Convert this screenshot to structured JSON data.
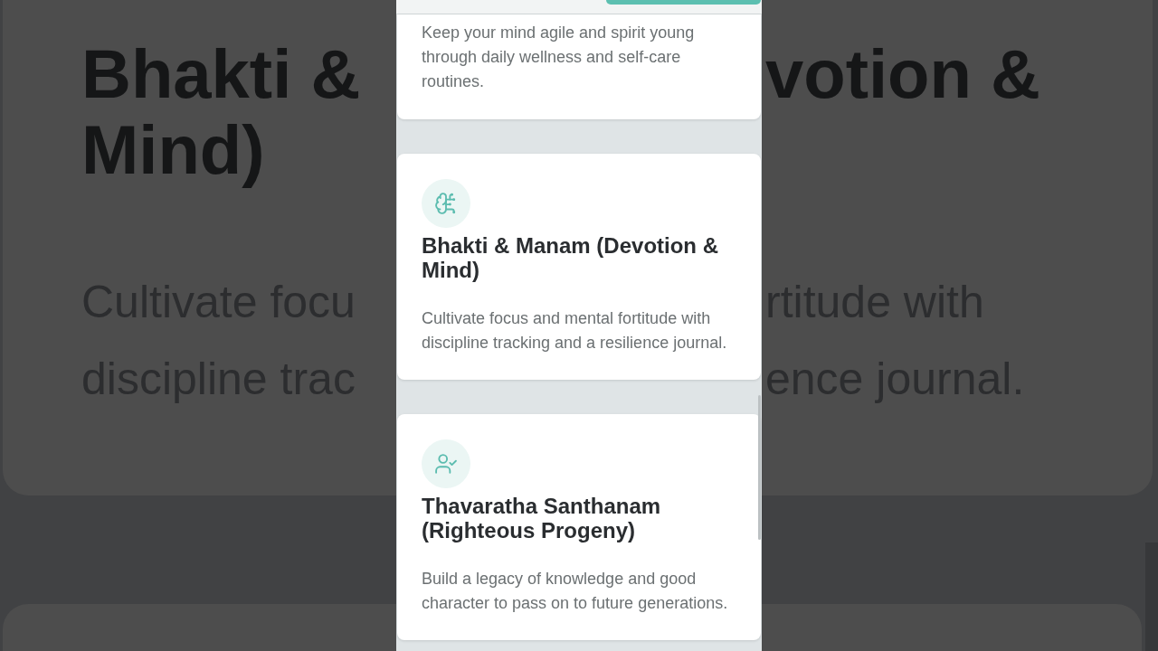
{
  "backdrop": {
    "title_lines": [
      {
        "left": "Bhakti &",
        "right": "votion &"
      },
      {
        "left": "Mind)"
      }
    ],
    "description_lines": [
      {
        "left": "Cultivate focu",
        "right": "rtitude with"
      },
      {
        "left": "discipline trac",
        "right": "ence journal."
      }
    ]
  },
  "screen": {
    "partial_card": {
      "description": "Keep your mind agile and spirit young through daily wellness and self-care routines."
    },
    "cards": [
      {
        "title": "Bhakti & Manam (Devotion & Mind)",
        "description": "Cultivate focus and mental fortitude with discipline tracking and a resilience journal."
      },
      {
        "title": "Thavaratha Santhanam (Righteous Progeny)",
        "description": "Build a legacy of knowledge and good character to pass on to future generations."
      }
    ]
  }
}
